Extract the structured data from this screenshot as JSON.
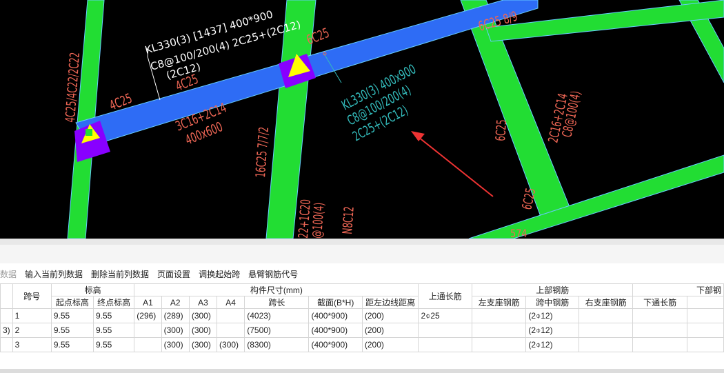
{
  "cad": {
    "beam_label_selected": [
      "KL330(3) [1437] 400*900",
      "C8@100/200(4) 2C25+(2C12)",
      "(2C12)"
    ],
    "beam_label_original": [
      "KL330(3) 400x900",
      "C8@100/200(4)",
      "2C25+(2C12)"
    ],
    "texts": {
      "t_4c25_4c22": "4C25/4C22/2C22",
      "t_4c25_left": "4C25",
      "t_4c25_mid": "4C25",
      "t_6c25_top": "6C25",
      "t_3c16": "3C16+2C14",
      "t_400x600": "400x600",
      "t_16c25": "16C25 7/7/2",
      "t_c20": "22+1C20",
      "t_100_4": "@100(4)",
      "t_n8c12": "N8C12",
      "t_6c25_right": "6C25",
      "t_2c16": "2C16+2C14",
      "t_c8_100": "C8@100(4)",
      "t_6c25_bottom": "6C25",
      "t_6c25_89": "6C25 8/9",
      "t_574": "574"
    },
    "colors": {
      "beam": "#2e6cf5",
      "column": "#22dd33",
      "column_edge": "#66ccff",
      "support": "#8800ff",
      "marker": "#ffff00",
      "text_red": "#ee6655",
      "text_cyan": "#33bbbb",
      "arrow": "#ee3333"
    }
  },
  "toolbar": {
    "items": [
      "数据",
      "输入当前列数据",
      "删除当前列数据",
      "页面设置",
      "调换起始跨",
      "悬臂钢筋代号"
    ]
  },
  "grid": {
    "headers_top": {
      "span": "跨号",
      "elevation": "标高",
      "dims": "构件尺寸(mm)",
      "top_through": "上通长筋",
      "top_rebar": "上部钢筋",
      "bottom_rebar": "下部钢"
    },
    "headers_sub": [
      "起点标高",
      "终点标高",
      "A1",
      "A2",
      "A3",
      "A4",
      "跨长",
      "截面(B*H)",
      "距左边线距离",
      "左支座钢筋",
      "跨中钢筋",
      "右支座钢筋",
      "下通长筋"
    ],
    "rows": [
      {
        "prefix": "",
        "span": "1",
        "start": "9.55",
        "end": "9.55",
        "a1": "(296)",
        "a2": "(289)",
        "a3": "(300)",
        "a4": "",
        "len": "(4023)",
        "sec": "(400*900)",
        "dist": "(200)",
        "top": "2⌽25",
        "left": "",
        "mid": "(2⌽12)",
        "right": "",
        "bot": ""
      },
      {
        "prefix": "3)",
        "span": "2",
        "start": "9.55",
        "end": "9.55",
        "a1": "",
        "a2": "(300)",
        "a3": "(300)",
        "a4": "",
        "len": "(7500)",
        "sec": "(400*900)",
        "dist": "(200)",
        "top": "",
        "left": "",
        "mid": "(2⌽12)",
        "right": "",
        "bot": ""
      },
      {
        "prefix": "",
        "span": "3",
        "start": "9.55",
        "end": "9.55",
        "a1": "",
        "a2": "(300)",
        "a3": "(300)",
        "a4": "(300)",
        "len": "(8300)",
        "sec": "(400*900)",
        "dist": "(200)",
        "top": "",
        "left": "",
        "mid": "(2⌽12)",
        "right": "",
        "bot": ""
      }
    ]
  }
}
